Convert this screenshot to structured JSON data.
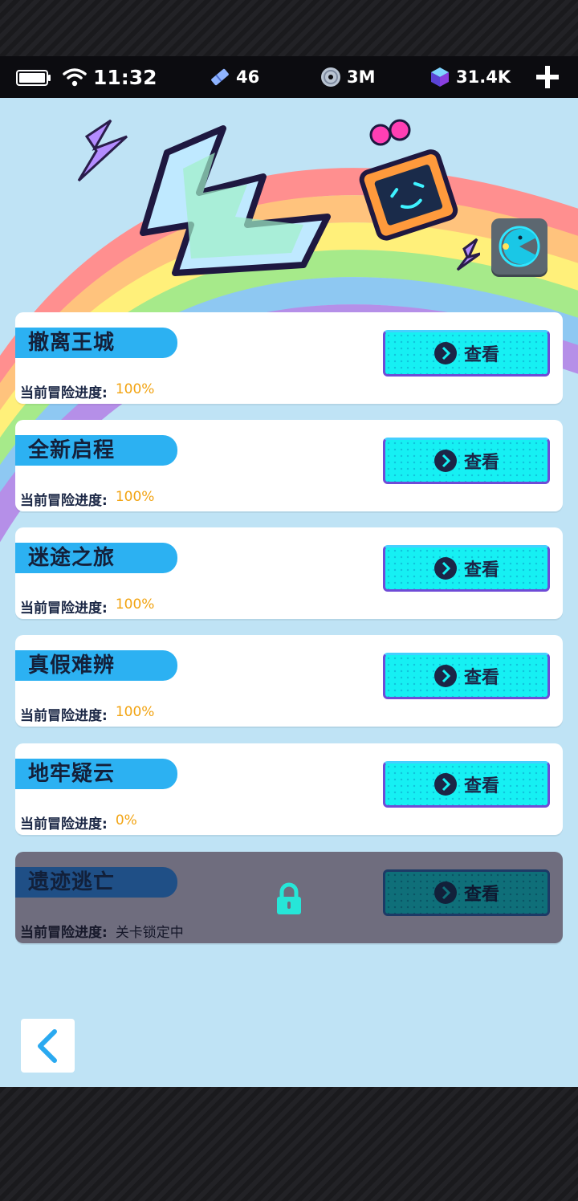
{
  "status_bar": {
    "time": "11:32",
    "tickets": "46",
    "discs": "3M",
    "gems": "31.4K"
  },
  "levels": [
    {
      "name": "撤离王城",
      "progress_label": "当前冒险进度:",
      "progress_value": "100%",
      "button_label": "查看",
      "locked": false
    },
    {
      "name": "全新启程",
      "progress_label": "当前冒险进度:",
      "progress_value": "100%",
      "button_label": "查看",
      "locked": false
    },
    {
      "name": "迷途之旅",
      "progress_label": "当前冒险进度:",
      "progress_value": "100%",
      "button_label": "查看",
      "locked": false
    },
    {
      "name": "真假难辨",
      "progress_label": "当前冒险进度:",
      "progress_value": "100%",
      "button_label": "查看",
      "locked": false
    },
    {
      "name": "地牢疑云",
      "progress_label": "当前冒险进度:",
      "progress_value": "0%",
      "button_label": "查看",
      "locked": false
    },
    {
      "name": "遗迹逃亡",
      "progress_label": "当前冒险进度:",
      "progress_value": "关卡锁定中",
      "button_label": "查看",
      "locked": true
    }
  ],
  "icons": {
    "battery": "battery-icon",
    "wifi": "wifi-icon",
    "tickets": "ticket-icon",
    "discs": "disc-icon",
    "gems": "gem-cube-icon",
    "add": "plus-icon",
    "pacman": "pacman-icon",
    "lock": "lock-icon",
    "back": "chevron-left-icon",
    "view": "chevron-right-circle-icon"
  },
  "colors": {
    "accent_cyan": "#16f0f3",
    "name_tag_blue": "#2cb1f2",
    "progress_orange": "#f2a413",
    "background": "#bfe3f5",
    "locked_card": "#6f6d7e"
  }
}
